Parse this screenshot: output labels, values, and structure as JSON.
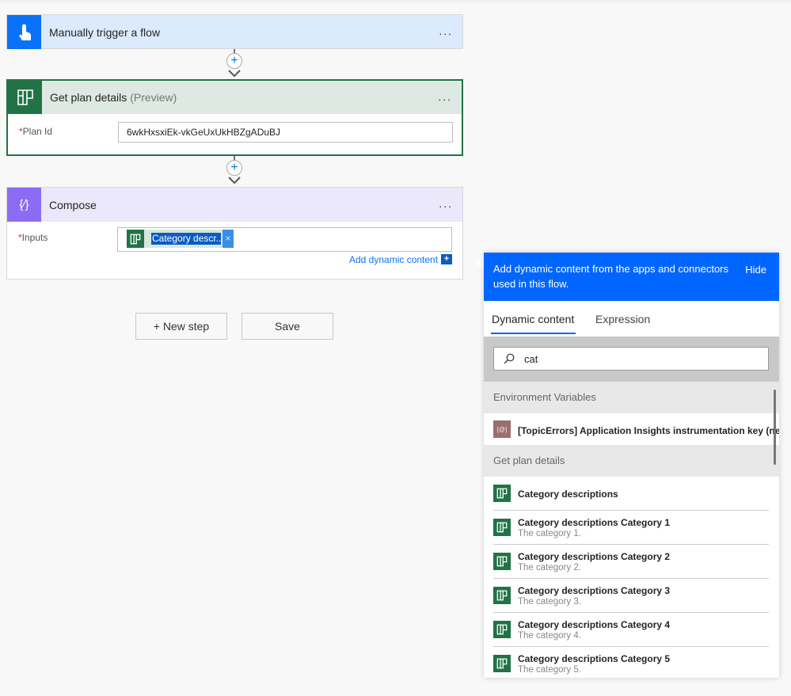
{
  "flow": {
    "trigger": {
      "title": "Manually trigger a flow",
      "more": "..."
    },
    "plan": {
      "title": "Get plan details",
      "suffix": "(Preview)",
      "more": "...",
      "field_label": "Plan Id",
      "field_value": "6wkHxsxiEk-vkGeUxUkHBZgADuBJ"
    },
    "compose": {
      "title": "Compose",
      "more": "...",
      "field_label": "Inputs",
      "token_label": "Category descr...",
      "token_remove": "×",
      "add_dynamic": "Add dynamic content",
      "add_icon": "+"
    },
    "connector_plus": "+",
    "required_mark": "*",
    "new_step": "+ New step",
    "save": "Save"
  },
  "panel": {
    "header": "Add dynamic content from the apps and connectors used in this flow.",
    "hide": "Hide",
    "tabs": [
      {
        "label": "Dynamic content",
        "active": true
      },
      {
        "label": "Expression",
        "active": false
      }
    ],
    "search_value": "cat",
    "sections": [
      {
        "title": "Environment Variables",
        "items": [
          {
            "title": "[TopicErrors] Application Insights instrumentation key (ne...",
            "icon": "environment-variable-icon"
          }
        ]
      },
      {
        "title": "Get plan details",
        "items": [
          {
            "title": "Category descriptions"
          },
          {
            "title": "Category descriptions Category 1",
            "subtitle": "The category 1."
          },
          {
            "title": "Category descriptions Category 2",
            "subtitle": "The category 2."
          },
          {
            "title": "Category descriptions Category 3",
            "subtitle": "The category 3."
          },
          {
            "title": "Category descriptions Category 4",
            "subtitle": "The category 4."
          },
          {
            "title": "Category descriptions Category 5",
            "subtitle": "The category 5."
          }
        ]
      }
    ]
  },
  "colors": {
    "trigger": "#0a72f8",
    "planner": "#217346",
    "compose": "#8c6cf4",
    "panel_header": "#0066ff"
  }
}
